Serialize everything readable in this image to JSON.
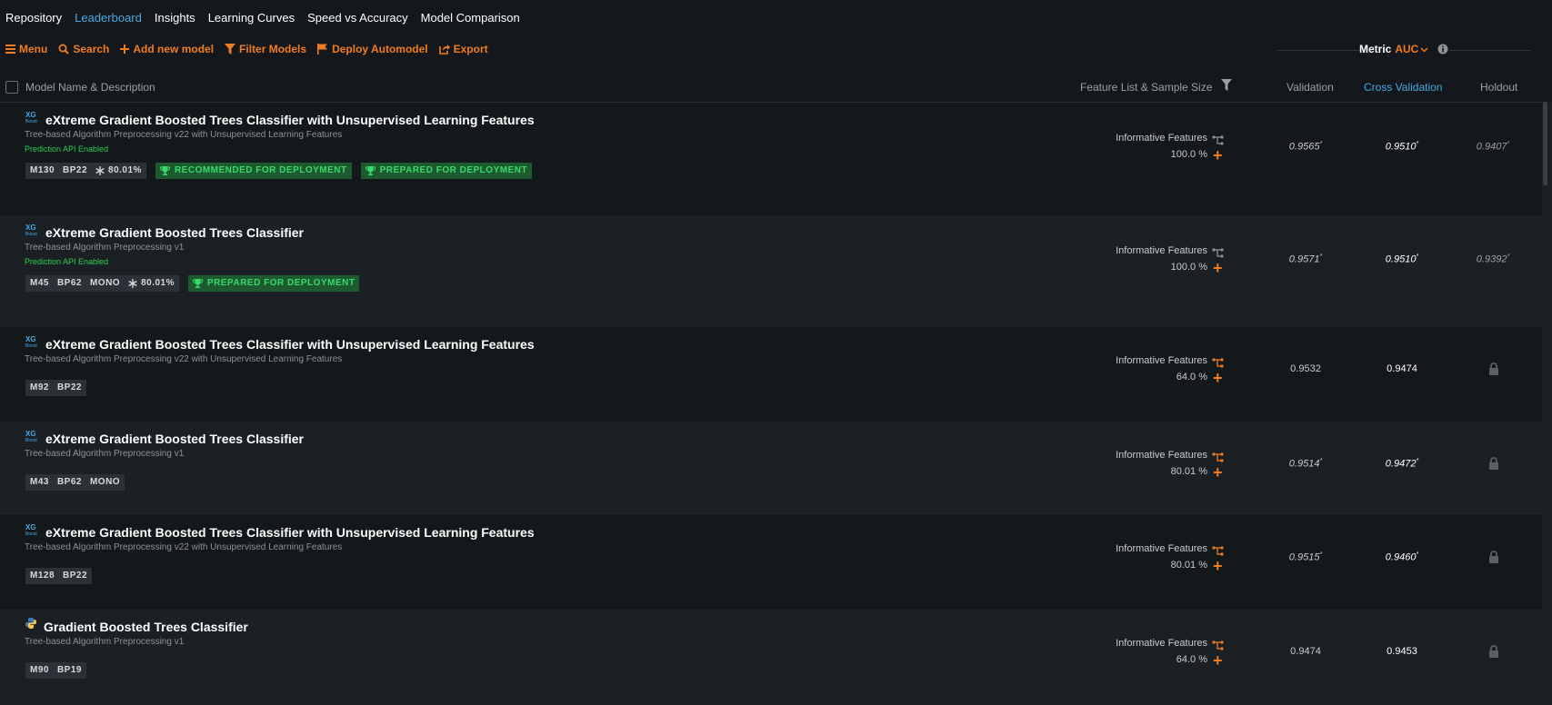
{
  "nav": {
    "tabs": [
      "Repository",
      "Leaderboard",
      "Insights",
      "Learning Curves",
      "Speed vs Accuracy",
      "Model Comparison"
    ]
  },
  "toolbar": {
    "menu": "Menu",
    "search": "Search",
    "add": "Add new model",
    "filter": "Filter Models",
    "deploy": "Deploy Automodel",
    "export": "Export"
  },
  "metric": {
    "label": "Metric",
    "value": "AUC"
  },
  "columns": {
    "name": "Model Name & Description",
    "feature": "Feature List & Sample Size",
    "validation": "Validation",
    "cross_validation": "Cross Validation",
    "holdout": "Holdout"
  },
  "colors": {
    "accent": "#f07c1f",
    "link": "#48a8e0",
    "green": "#39d96a"
  },
  "models": [
    {
      "logo": "xgboost-logo",
      "title": "eXtreme Gradient Boosted Trees Classifier with Unsupervised Learning Features",
      "desc": "Tree-based Algorithm Preprocessing v22 with Unsupervised Learning Features",
      "api": "Prediction API Enabled",
      "badge": {
        "m": "M130",
        "bp": "BP22",
        "mono": "",
        "pct": "80.01%"
      },
      "tags": [
        "RECOMMENDED FOR DEPLOYMENT",
        "PREPARED FOR DEPLOYMENT"
      ],
      "feature_list": "Informative Features",
      "sample": "100.0 %",
      "validation": "0.9565",
      "cross_validation": "0.9510",
      "holdout": "0.9407",
      "star": "*"
    },
    {
      "logo": "xgboost-logo",
      "title": "eXtreme Gradient Boosted Trees Classifier",
      "desc": "Tree-based Algorithm Preprocessing v1",
      "api": "Prediction API Enabled",
      "badge": {
        "m": "M45",
        "bp": "BP62",
        "mono": "MONO",
        "pct": "80.01%"
      },
      "tags": [
        "PREPARED FOR DEPLOYMENT"
      ],
      "feature_list": "Informative Features",
      "sample": "100.0 %",
      "validation": "0.9571",
      "cross_validation": "0.9510",
      "holdout": "0.9392",
      "star": "*"
    },
    {
      "logo": "xgboost-logo",
      "title": "eXtreme Gradient Boosted Trees Classifier with Unsupervised Learning Features",
      "desc": "Tree-based Algorithm Preprocessing v22 with Unsupervised Learning Features",
      "api": "",
      "badge": {
        "m": "M92",
        "bp": "BP22",
        "mono": "",
        "pct": ""
      },
      "tags": [],
      "feature_list": "Informative Features",
      "sample": "64.0 %",
      "validation": "0.9532",
      "cross_validation": "0.9474",
      "holdout": "",
      "star": ""
    },
    {
      "logo": "xgboost-logo",
      "title": "eXtreme Gradient Boosted Trees Classifier",
      "desc": "Tree-based Algorithm Preprocessing v1",
      "api": "",
      "badge": {
        "m": "M43",
        "bp": "BP62",
        "mono": "MONO",
        "pct": ""
      },
      "tags": [],
      "feature_list": "Informative Features",
      "sample": "80.01 %",
      "validation": "0.9514",
      "cross_validation": "0.9472",
      "holdout": "",
      "star": "*"
    },
    {
      "logo": "xgboost-logo",
      "title": "eXtreme Gradient Boosted Trees Classifier with Unsupervised Learning Features",
      "desc": "Tree-based Algorithm Preprocessing v22 with Unsupervised Learning Features",
      "api": "",
      "badge": {
        "m": "M128",
        "bp": "BP22",
        "mono": "",
        "pct": ""
      },
      "tags": [],
      "feature_list": "Informative Features",
      "sample": "80.01 %",
      "validation": "0.9515",
      "cross_validation": "0.9460",
      "holdout": "",
      "star": "*"
    },
    {
      "logo": "python-logo",
      "title": "Gradient Boosted Trees Classifier",
      "desc": "Tree-based Algorithm Preprocessing v1",
      "api": "",
      "badge": {
        "m": "M90",
        "bp": "BP19",
        "mono": "",
        "pct": ""
      },
      "tags": [],
      "feature_list": "Informative Features",
      "sample": "64.0 %",
      "validation": "0.9474",
      "cross_validation": "0.9453",
      "holdout": "",
      "star": ""
    }
  ]
}
